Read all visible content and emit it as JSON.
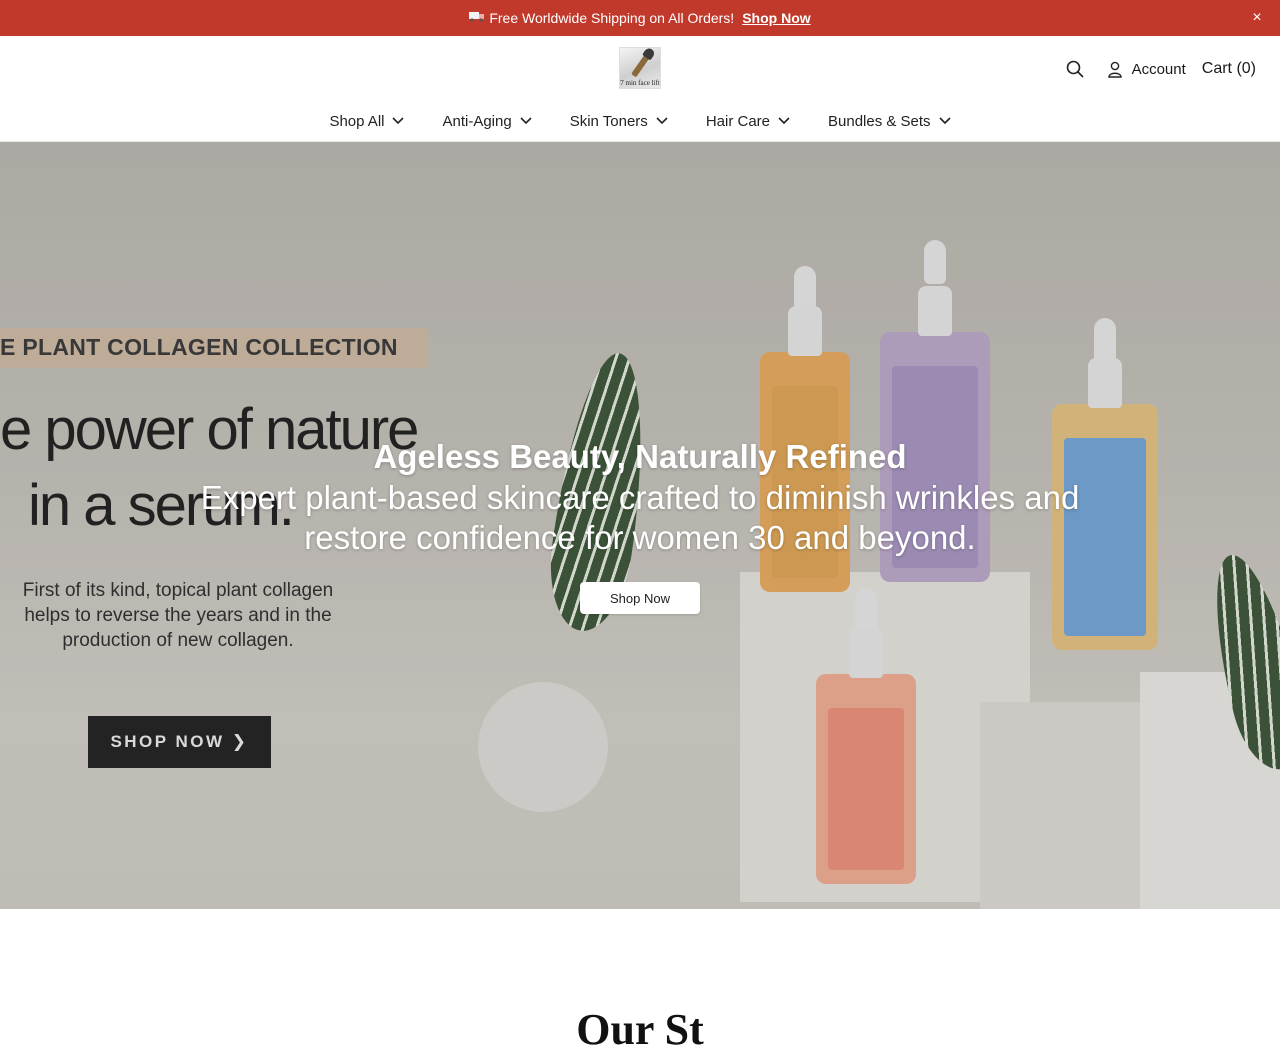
{
  "announcement": {
    "truck_icon": "truck-icon",
    "text": "Free Worldwide Shipping on All Orders!",
    "link": "Shop Now",
    "close": "×"
  },
  "header": {
    "logo_text": "7 min face lift",
    "account_label": "Account",
    "cart_label": "Cart (0)"
  },
  "nav": {
    "items": [
      {
        "label": "Shop All"
      },
      {
        "label": "Anti-Aging"
      },
      {
        "label": "Skin Toners"
      },
      {
        "label": "Hair Care"
      },
      {
        "label": "Bundles & Sets"
      }
    ]
  },
  "hero": {
    "image_banner": "E PLANT COLLAGEN COLLECTION",
    "image_headline_1": "e power of nature",
    "image_headline_2": "in a serum.",
    "image_body": "First of its kind, topical plant collagen helps to reverse the years and in the production of new collagen.",
    "image_button": "SHOP NOW ❯",
    "title": "Ageless Beauty, Naturally Refined",
    "subtitle": "Expert plant-based skincare crafted to diminish wrinkles and restore confidence for women 30 and beyond.",
    "button": "Shop Now"
  },
  "section": {
    "title_partial": "Our St"
  },
  "colors": {
    "announcement_bg": "#c0392b",
    "hero_bg": "#c2bdb6"
  }
}
